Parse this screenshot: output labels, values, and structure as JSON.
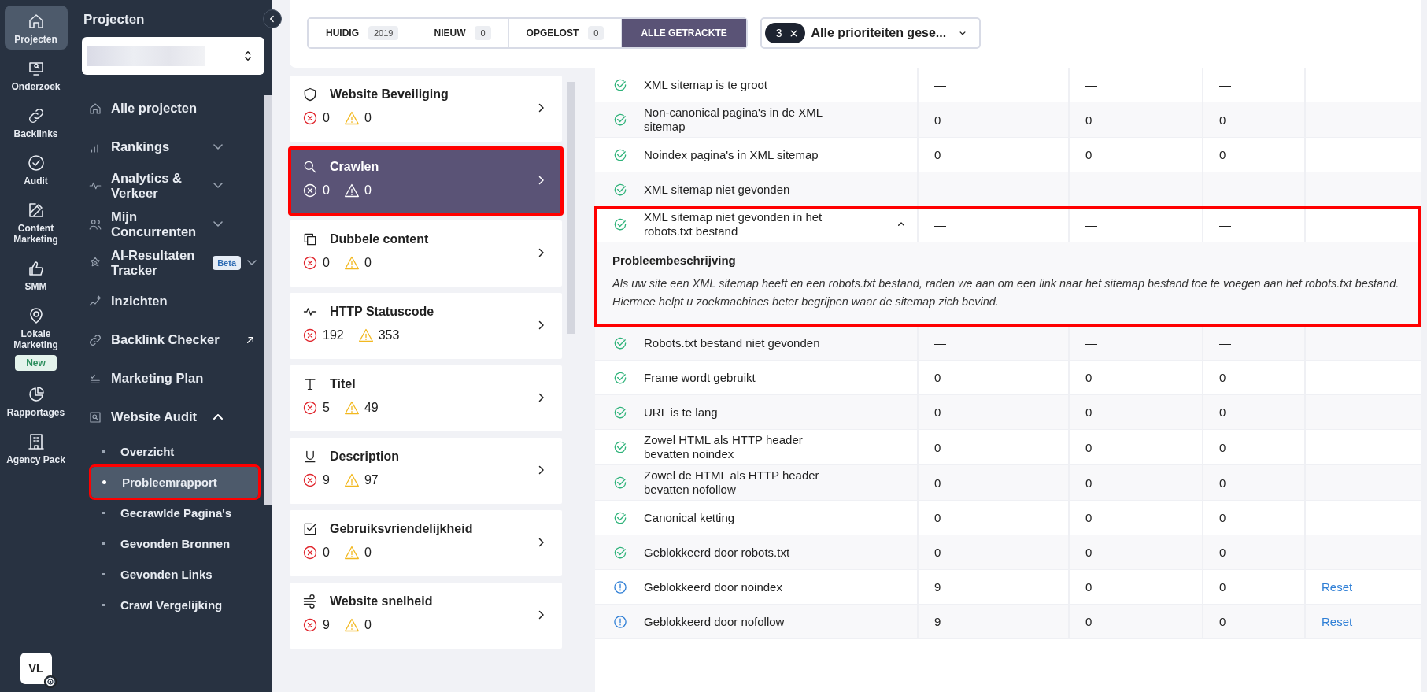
{
  "rail": [
    {
      "label": "Projecten",
      "selected": true
    },
    {
      "label": "Onderzoek",
      "selected": false
    },
    {
      "label": "Backlinks",
      "selected": false
    },
    {
      "label": "Audit",
      "selected": false
    },
    {
      "label": "Content Marketing",
      "selected": false
    },
    {
      "label": "SMM",
      "selected": false
    },
    {
      "label": "Lokale Marketing",
      "selected": false,
      "badge": "New"
    },
    {
      "label": "Rapportages",
      "selected": false
    },
    {
      "label": "Agency Pack",
      "selected": false
    }
  ],
  "avatar": "VL",
  "sidebar": {
    "title": "Projecten",
    "items": [
      {
        "label": "Alle projecten",
        "kind": "plain"
      },
      {
        "label": "Rankings",
        "kind": "group",
        "expanded": false
      },
      {
        "label": "Analytics & Verkeer",
        "kind": "group",
        "expanded": false
      },
      {
        "label": "Mijn Concurrenten",
        "kind": "group",
        "expanded": false
      },
      {
        "label": "AI-Resultaten Tracker",
        "kind": "group",
        "expanded": false,
        "badge": "Beta"
      },
      {
        "label": "Inzichten",
        "kind": "plain"
      },
      {
        "label": "Backlink Checker",
        "kind": "external"
      },
      {
        "label": "Marketing Plan",
        "kind": "plain"
      },
      {
        "label": "Website Audit",
        "kind": "group",
        "expanded": true,
        "children": [
          {
            "label": "Overzicht",
            "selected": false
          },
          {
            "label": "Probleemrapport",
            "selected": true,
            "annotated": true
          },
          {
            "label": "Gecrawlde Pagina's",
            "selected": false
          },
          {
            "label": "Gevonden Bronnen",
            "selected": false
          },
          {
            "label": "Gevonden Links",
            "selected": false
          },
          {
            "label": "Crawl Vergelijking",
            "selected": false
          }
        ]
      }
    ]
  },
  "filter_tabs": [
    {
      "label": "HUIDIG",
      "count": "2019",
      "selected": false
    },
    {
      "label": "NIEUW",
      "count": "0",
      "selected": false
    },
    {
      "label": "OPGELOST",
      "count": "0",
      "selected": false
    },
    {
      "label": "ALLE GETRACKTE",
      "selected": true
    }
  ],
  "priority_filter": {
    "count": "3",
    "label": "Alle prioriteiten gese..."
  },
  "categories": [
    {
      "name": "Website Beveiliging",
      "errors": "0",
      "warnings": "0",
      "selected": false
    },
    {
      "name": "Crawlen",
      "errors": "0",
      "warnings": "0",
      "selected": true,
      "annotated": true
    },
    {
      "name": "Dubbele content",
      "errors": "0",
      "warnings": "0",
      "selected": false
    },
    {
      "name": "HTTP Statuscode",
      "errors": "192",
      "warnings": "353",
      "selected": false
    },
    {
      "name": "Titel",
      "errors": "5",
      "warnings": "49",
      "selected": false
    },
    {
      "name": "Description",
      "errors": "9",
      "warnings": "97",
      "selected": false
    },
    {
      "name": "Gebruiksvriendelijkheid",
      "errors": "0",
      "warnings": "0",
      "selected": false
    },
    {
      "name": "Website snelheid",
      "errors": "9",
      "warnings": "0",
      "selected": false
    }
  ],
  "table": {
    "rows": [
      {
        "kind": "ok",
        "name": "XML sitemap is te groot",
        "column_2": "—",
        "column_3": "—",
        "column_4": "—"
      },
      {
        "kind": "ok",
        "name": "Non-canonical pagina's in de XML sitemap",
        "column_2": "0",
        "column_3": "0",
        "column_4": "0"
      },
      {
        "kind": "ok",
        "name": "Noindex pagina's in XML sitemap",
        "column_2": "0",
        "column_3": "0",
        "column_4": "0"
      },
      {
        "kind": "ok",
        "name": "XML sitemap niet gevonden",
        "column_2": "—",
        "column_3": "—",
        "column_4": "—"
      },
      {
        "kind": "ok",
        "name": "XML sitemap niet gevonden in het robots.txt bestand",
        "column_2": "—",
        "column_3": "—",
        "column_4": "—",
        "expanded": true,
        "annotated": true,
        "description_title": "Probleembeschrijving",
        "description": "Als uw site een XML sitemap heeft en een robots.txt bestand, raden we aan om een link naar het sitemap bestand toe te voegen aan het robots.txt bestand. Hiermee helpt u zoekmachines beter begrijpen waar de sitemap zich bevind."
      },
      {
        "kind": "ok",
        "name": "Robots.txt bestand niet gevonden",
        "column_2": "—",
        "column_3": "—",
        "column_4": "—"
      },
      {
        "kind": "ok",
        "name": "Frame wordt gebruikt",
        "column_2": "0",
        "column_3": "0",
        "column_4": "0"
      },
      {
        "kind": "ok",
        "name": "URL is te lang",
        "column_2": "0",
        "column_3": "0",
        "column_4": "0"
      },
      {
        "kind": "ok",
        "name": "Zowel HTML als HTTP header bevatten noindex",
        "column_2": "0",
        "column_3": "0",
        "column_4": "0"
      },
      {
        "kind": "ok",
        "name": "Zowel de HTML als HTTP header bevatten nofollow",
        "column_2": "0",
        "column_3": "0",
        "column_4": "0"
      },
      {
        "kind": "ok",
        "name": "Canonical ketting",
        "column_2": "0",
        "column_3": "0",
        "column_4": "0"
      },
      {
        "kind": "ok",
        "name": "Geblokkeerd door robots.txt",
        "column_2": "0",
        "column_3": "0",
        "column_4": "0"
      },
      {
        "kind": "info",
        "name": "Geblokkeerd door noindex",
        "column_2": "9",
        "column_3": "0",
        "column_4": "0",
        "action": "Reset"
      },
      {
        "kind": "info",
        "name": "Geblokkeerd door nofollow",
        "column_2": "9",
        "column_3": "0",
        "column_4": "0",
        "action": "Reset"
      }
    ]
  }
}
